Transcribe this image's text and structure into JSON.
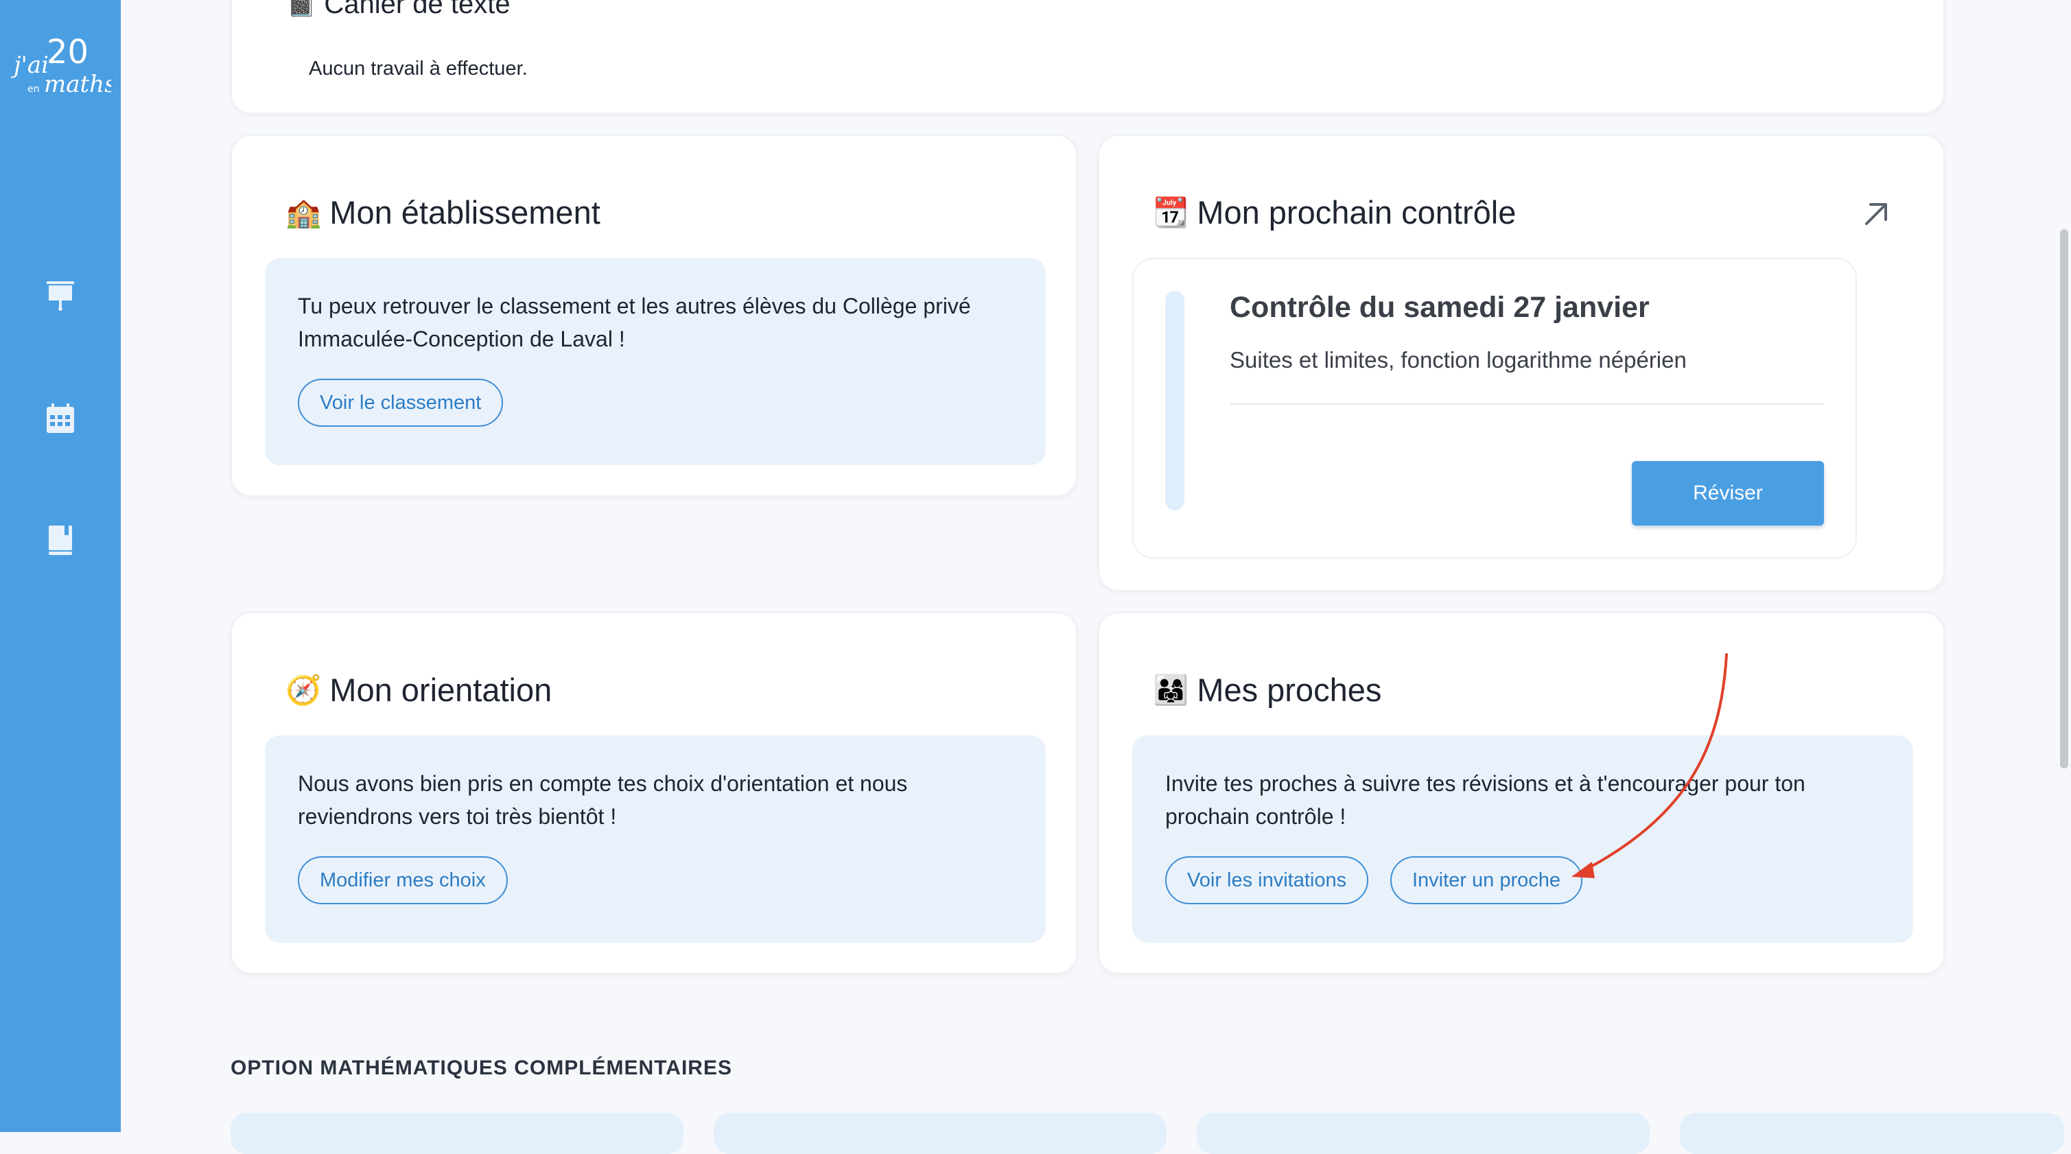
{
  "app": {
    "logo_text_top": "j'ai",
    "logo_number": "20",
    "logo_text_small": "en",
    "logo_text_bottom": "maths"
  },
  "sidebar": {
    "items": [
      {
        "icon": "presentation-board-icon"
      },
      {
        "icon": "calendar-icon"
      },
      {
        "icon": "book-icon"
      }
    ]
  },
  "cahier": {
    "title": "Cahier de texte",
    "emoji": "📓",
    "message": "Aucun travail à effectuer."
  },
  "etablissement": {
    "emoji": "🏫",
    "title": "Mon établissement",
    "text": "Tu peux retrouver le classement et les autres élèves du Collège privé Immaculée-Conception de Laval !",
    "button": "Voir le classement"
  },
  "controle": {
    "emoji": "📆",
    "title": "Mon prochain contrôle",
    "link_icon": "arrow-up-right-icon",
    "heading": "Contrôle du samedi 27 janvier",
    "subtitle": "Suites et limites, fonction logarithme népérien",
    "button": "Réviser"
  },
  "orientation": {
    "emoji": "🧭",
    "title": "Mon orientation",
    "text": "Nous avons bien pris en compte tes choix d'orientation et nous reviendrons vers toi très bientôt !",
    "button": "Modifier mes choix"
  },
  "proches": {
    "emoji": "👨‍👩‍👧",
    "title": "Mes proches",
    "text": "Invite tes proches à suivre tes révisions et à t'encourager pour ton prochain contrôle !",
    "buttons": [
      "Voir les invitations",
      "Inviter un proche"
    ]
  },
  "section": {
    "heading": "OPTION MATHÉMATIQUES COMPLÉMENTAIRES"
  },
  "colors": {
    "sidebar": "#4a9ee2",
    "accent": "#3f8fd6",
    "panel": "#e9f2fb",
    "annotation_arrow": "#e0402a",
    "primary_button": "#4a9ee2"
  }
}
